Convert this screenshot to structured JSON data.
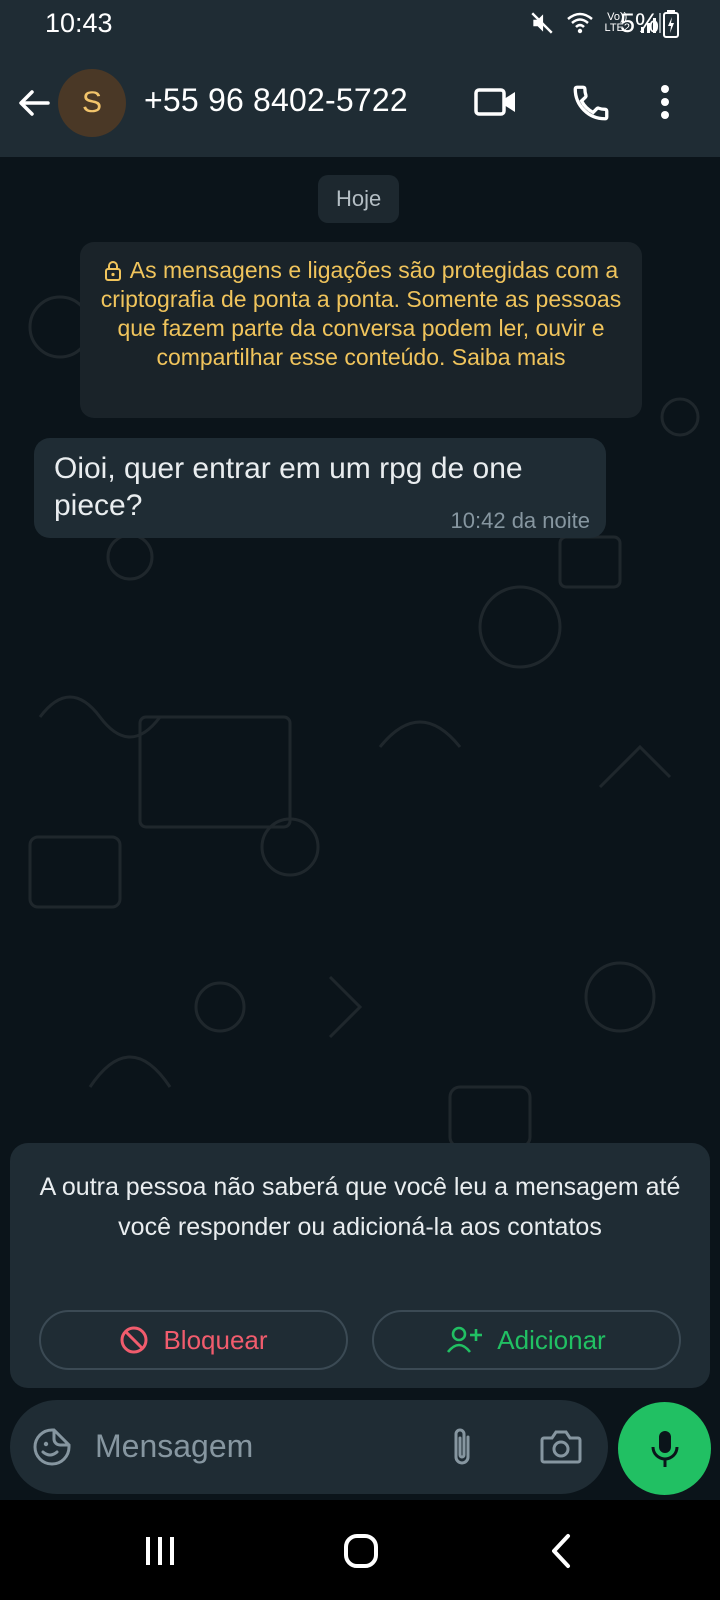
{
  "status_bar": {
    "time": "10:43",
    "network_label_top": "Vo))",
    "network_label_bottom": "LTE2",
    "battery": "5%"
  },
  "header": {
    "avatar_initial": "S",
    "contact": "+55 96 8402-5722",
    "icons": [
      "back-arrow-icon",
      "video-call-icon",
      "phone-icon",
      "more-vert-icon"
    ]
  },
  "chat": {
    "date_chip": "Hoje",
    "encryption_notice": "As mensagens e ligações são protegidas com a criptografia de ponta a ponta. Somente as pessoas que fazem parte da conversa podem ler, ouvir e compartilhar esse conteúdo. Saiba mais",
    "messages": [
      {
        "text": "Oioi, quer entrar em um rpg de one piece?",
        "time": "10:42 da noite",
        "direction": "incoming"
      }
    ]
  },
  "unknown_contact_panel": {
    "text": "A outra pessoa não saberá que você leu a mensagem até você responder ou adicioná-la aos contatos",
    "block_label": "Bloquear",
    "add_label": "Adicionar"
  },
  "compose": {
    "placeholder": "Mensagem",
    "icons": [
      "sticker-icon",
      "paperclip-icon",
      "camera-icon",
      "mic-icon"
    ]
  },
  "colors": {
    "background": "#0b141a",
    "bar": "#1f2c34",
    "accent_green": "#21c063",
    "danger_red": "#f15c6d",
    "notice_yellow": "#f0c45c"
  }
}
